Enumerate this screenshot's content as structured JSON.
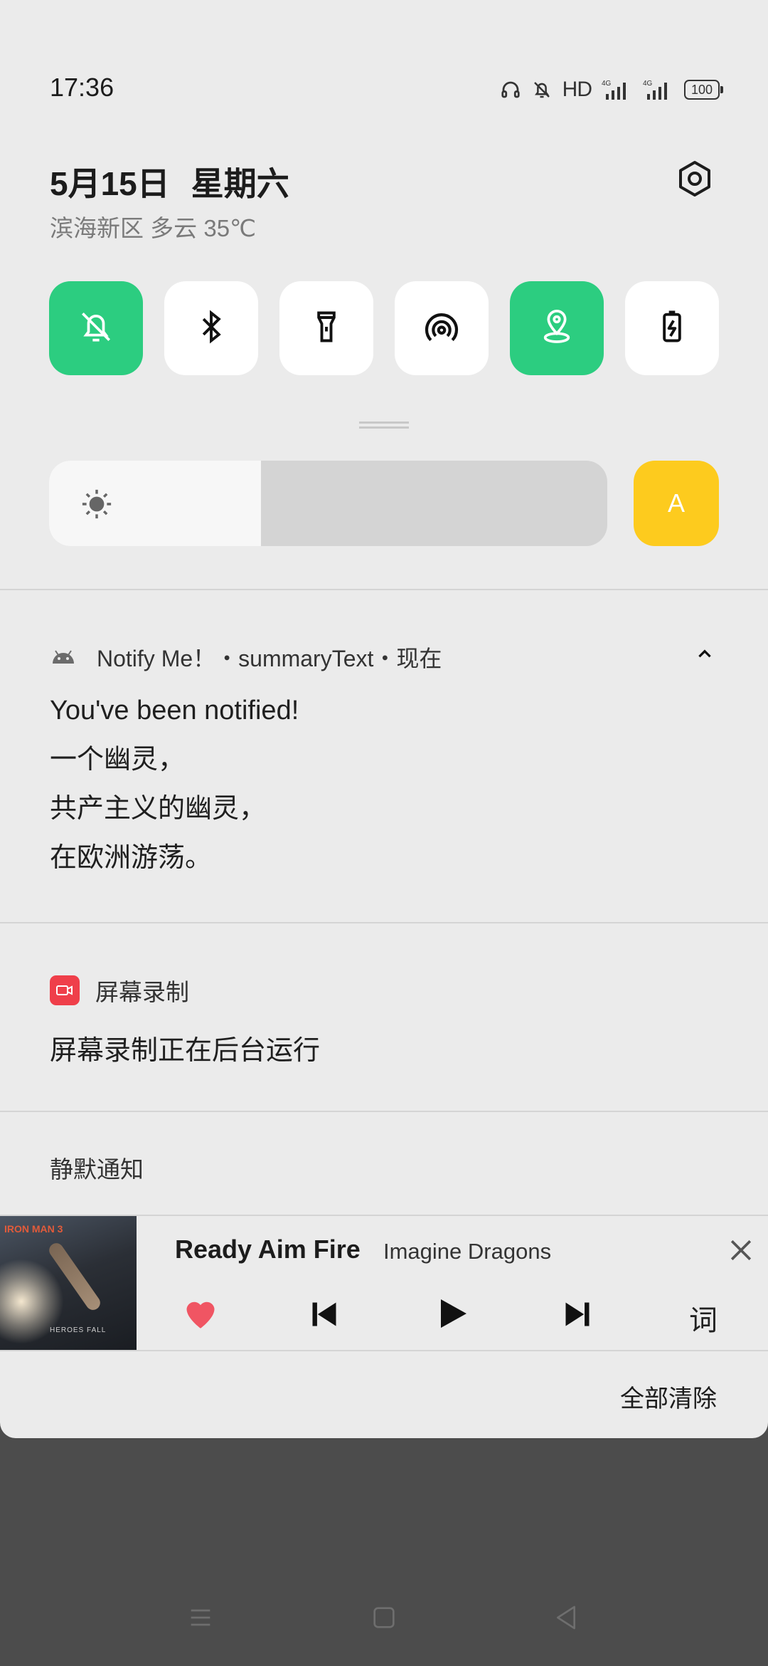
{
  "status": {
    "time": "17:36",
    "hd": "HD",
    "battery": "100"
  },
  "header": {
    "date": "5月15日",
    "weekday": "星期六",
    "weather": "滨海新区 多云 35℃"
  },
  "quick_toggles": [
    {
      "name": "silent",
      "icon": "bell-off-icon",
      "active": true
    },
    {
      "name": "bluetooth",
      "icon": "bluetooth-icon",
      "active": false
    },
    {
      "name": "flashlight",
      "icon": "flashlight-icon",
      "active": false
    },
    {
      "name": "hotspot",
      "icon": "hotspot-icon",
      "active": false
    },
    {
      "name": "location",
      "icon": "location-icon",
      "active": true
    },
    {
      "name": "battery-saver",
      "icon": "battery-charging-icon",
      "active": false
    }
  ],
  "brightness": {
    "level": 0.38,
    "auto_label": "A"
  },
  "notification_1": {
    "header": "Notify Me！・summaryText・现在",
    "lines": [
      "You've been notified!",
      "一个幽灵，",
      "共产主义的幽灵，",
      "在欧洲游荡。"
    ]
  },
  "notification_2": {
    "app": "屏幕录制",
    "text": "屏幕录制正在后台运行"
  },
  "silent_section": "静默通知",
  "media": {
    "title": "Ready Aim Fire",
    "artist": "Imagine Dragons",
    "lyrics_label": "词",
    "favorite": true
  },
  "clear_all": "全部清除",
  "colors": {
    "accent_green": "#2ccd80",
    "auto_yellow": "#fdcb1e",
    "record_red": "#ef3f4a",
    "heart_red": "#f05563"
  }
}
